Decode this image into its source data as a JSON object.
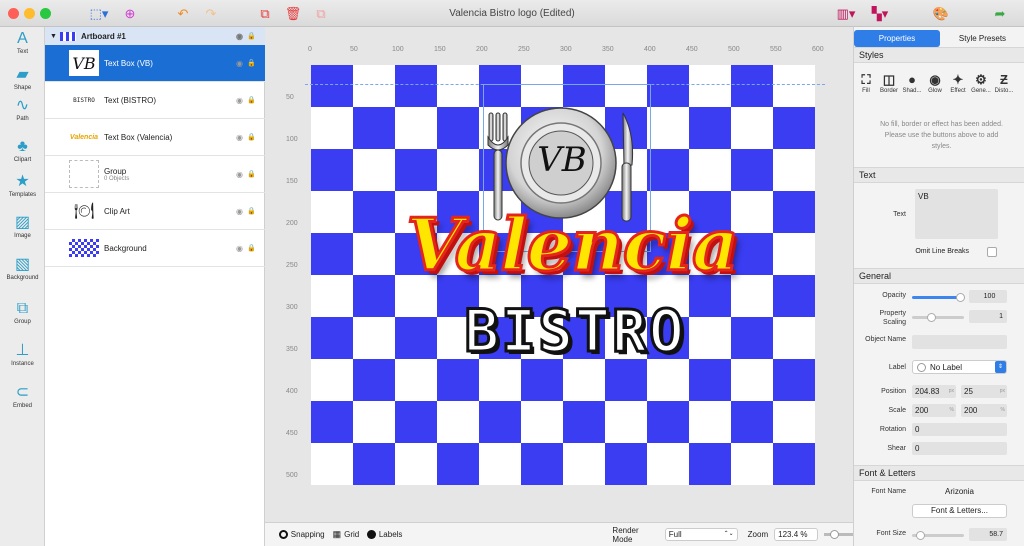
{
  "window": {
    "title": "Valencia Bistro logo (Edited)"
  },
  "tools": [
    {
      "label": "Text",
      "icon": "A"
    },
    {
      "label": "Shape",
      "icon": "▰"
    },
    {
      "label": "Path",
      "icon": "∿"
    },
    {
      "label": "Clipart",
      "icon": "♣"
    },
    {
      "label": "Templates",
      "icon": "★"
    },
    {
      "label": "Image",
      "icon": "▨"
    },
    {
      "label": "Background",
      "icon": "▧"
    },
    {
      "label": "Group",
      "icon": "⧉"
    },
    {
      "label": "Instance",
      "icon": "⊥"
    },
    {
      "label": "Embed",
      "icon": "⊂"
    }
  ],
  "layers": {
    "artboard": "Artboard #1",
    "items": [
      {
        "label": "Text Box (VB)",
        "thumb": "VB"
      },
      {
        "label": "Text (BISTRO)",
        "thumb": "BISTRO"
      },
      {
        "label": "Text Box (Valencia)",
        "thumb": "Valencia"
      },
      {
        "label": "Group",
        "sub": "0 Objects",
        "thumb": ""
      },
      {
        "label": "Clip Art",
        "thumb": "🍽"
      },
      {
        "label": "Background",
        "thumb": ""
      }
    ]
  },
  "canvas": {
    "hruler": [
      "0",
      "50",
      "100",
      "150",
      "200",
      "250",
      "300",
      "350",
      "400",
      "450",
      "500",
      "550",
      "600"
    ],
    "vruler": [
      "50",
      "100",
      "150",
      "200",
      "250",
      "300",
      "350",
      "400",
      "450",
      "500"
    ],
    "logo": {
      "monogram": "VB",
      "title": "Valencia",
      "subtitle": "BISTRO"
    },
    "checker_colors": {
      "blue": "#3a3df2",
      "white": "#ffffff"
    }
  },
  "bottombar": {
    "snapping": "Snapping",
    "grid": "Grid",
    "labels": "Labels",
    "render_mode_label": "Render Mode",
    "render_mode": "Full",
    "zoom_label": "Zoom",
    "zoom": "123.4 %"
  },
  "props": {
    "tabs": [
      "Properties",
      "Style Presets"
    ],
    "styles_header": "Styles",
    "style_buttons": [
      "Fill",
      "Border",
      "Shad...",
      "Glow",
      "Effect",
      "Gene...",
      "Disto..."
    ],
    "styles_note": "No fill, border or effect has been added. Please use the buttons above to add styles.",
    "text_header": "Text",
    "text_label": "Text",
    "text_value": "VB",
    "omit_line_breaks": "Omit Line Breaks",
    "general_header": "General",
    "opacity_label": "Opacity",
    "opacity": "100",
    "opacity_pct": 100,
    "scaling_label": "Property Scaling",
    "scaling": "1",
    "objname_label": "Object Name",
    "label_label": "Label",
    "label_value": "No Label",
    "position_label": "Position",
    "pos_x": "204.83",
    "pos_y": "25",
    "unit": "px",
    "scale_label": "Scale",
    "scale_x": "200",
    "scale_y": "200",
    "rotation_label": "Rotation",
    "rotation": "0",
    "shear_label": "Shear",
    "shear": "0",
    "font_header": "Font & Letters",
    "fontname_label": "Font Name",
    "fontname": "Arizonia",
    "font_button": "Font & Letters...",
    "fontsize_label": "Font Size",
    "fontsize": "58.7"
  }
}
